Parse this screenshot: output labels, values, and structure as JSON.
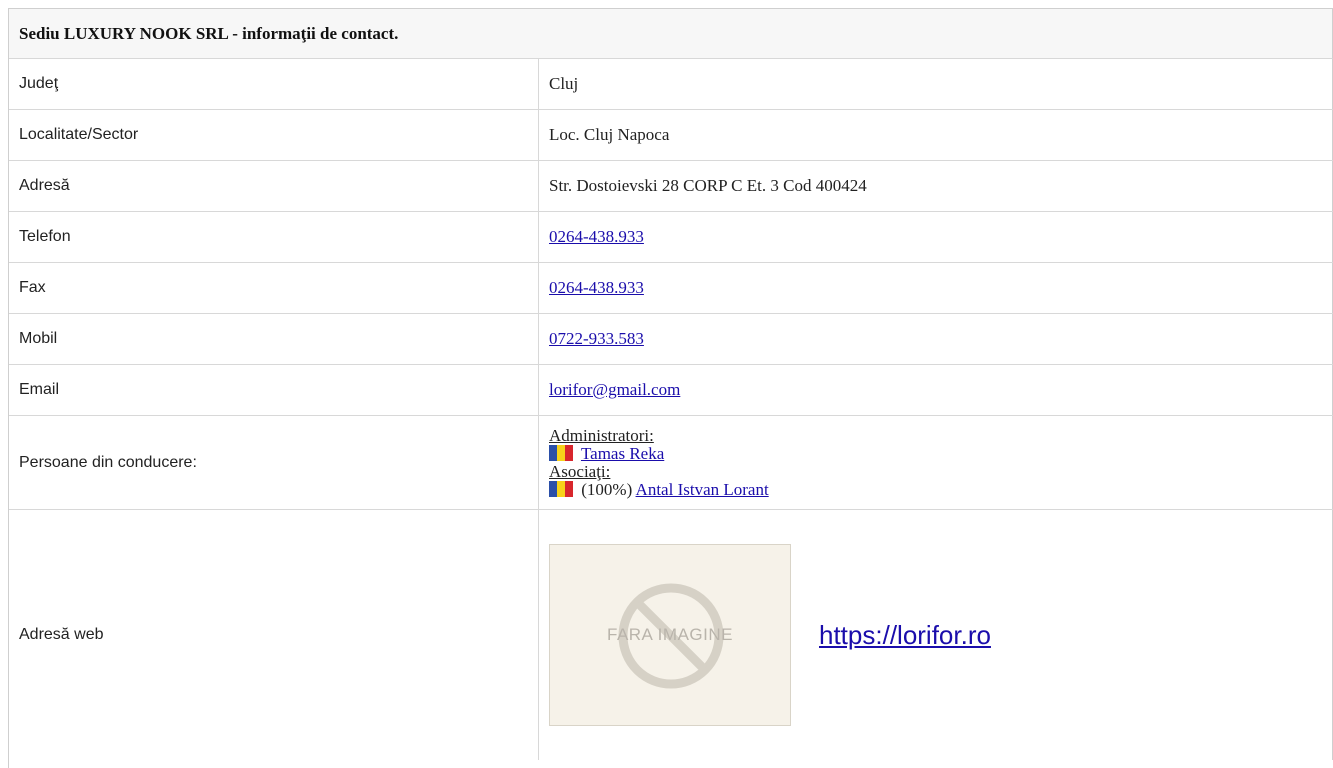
{
  "header": {
    "title": "Sediu LUXURY NOOK SRL - informaţii de contact."
  },
  "rows": {
    "judet": {
      "label": "Judeţ",
      "value": "Cluj"
    },
    "localitate": {
      "label": "Localitate/Sector",
      "value": "Loc. Cluj Napoca"
    },
    "adresa": {
      "label": "Adresă",
      "value": "Str. Dostoievski 28 CORP C Et. 3 Cod 400424"
    },
    "telefon": {
      "label": "Telefon",
      "value": "0264-438.933"
    },
    "fax": {
      "label": "Fax",
      "value": "0264-438.933"
    },
    "mobil": {
      "label": "Mobil",
      "value": "0722-933.583"
    },
    "email": {
      "label": "Email",
      "value": "lorifor@gmail.com"
    },
    "persoane": {
      "label": "Persoane din conducere:",
      "admin_label": "Administratori:",
      "admin_name": "Tamas Reka",
      "assoc_label": "Asociaţi:",
      "assoc_share": "(100%)",
      "assoc_name": "Antal Istvan Lorant",
      "flag_icon": "romania-flag-icon",
      "flag_colors": [
        "#2b4fa8",
        "#f7d21a",
        "#d8262c"
      ]
    },
    "web": {
      "label": "Adresă web",
      "placeholder_text": "FARA IMAGINE",
      "url": "https://lorifor.ro"
    }
  },
  "colors": {
    "link": "#1a0dab",
    "header_bg": "#f7f7f7",
    "border": "#d8d8d8"
  }
}
